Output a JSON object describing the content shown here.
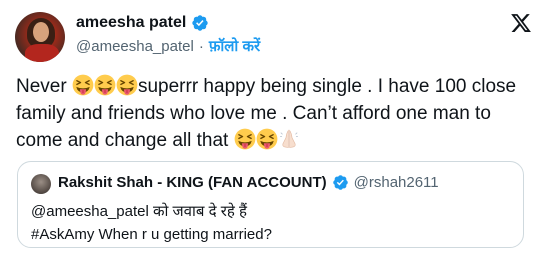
{
  "author": {
    "display_name": "ameesha patel",
    "handle": "@ameesha_patel",
    "separator": "·",
    "follow_label": "फ़ॉलो करें"
  },
  "tweet": {
    "seg1": "Never ",
    "seg2": "superrr happy being single . I have 100 close family and friends who love me . Can’t afford one man to come and change all that "
  },
  "quote": {
    "display_name": "Rakshit Shah - KING (FAN ACCOUNT)",
    "handle": "@rshah2611",
    "line1": "@ameesha_patel को जवाब दे रहे हैं",
    "line2": "#AskAmy When r u getting married?"
  },
  "icons": {
    "verified": "verified-badge-icon",
    "brand": "x-logo-icon",
    "emoji_tongue": "squinting-face-with-tongue-icon",
    "emoji_hands": "folded-hands-icon"
  },
  "colors": {
    "verified": "#1d9bf0",
    "link": "#1d9bf0",
    "secondary_text": "#536471",
    "border": "#cfd9de"
  }
}
